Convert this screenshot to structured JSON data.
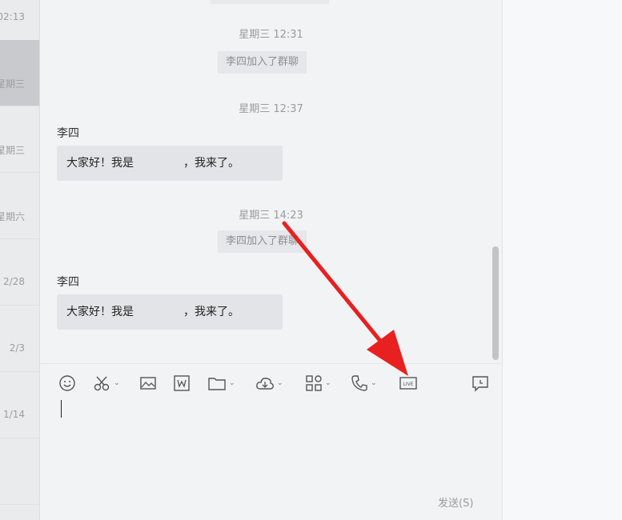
{
  "sidebar": {
    "items": [
      {
        "time": "02:13",
        "selected": false
      },
      {
        "time": "星期三",
        "selected": true
      },
      {
        "time": "星期三",
        "selected": false
      },
      {
        "time": "星期六",
        "selected": false
      },
      {
        "time": "2/28",
        "selected": false
      },
      {
        "time": "2/3",
        "selected": false
      },
      {
        "time": "1/14",
        "selected": false
      },
      {
        "time": "",
        "selected": false
      }
    ]
  },
  "chat": {
    "messages": [
      {
        "timestamp": "星期三 12:31",
        "system": "李四加入了群聊"
      },
      {
        "timestamp": "星期三 12:37",
        "sender": "李四",
        "text_start": "大家好！我是",
        "text_end": "，我来了。"
      },
      {
        "timestamp": "星期三 14:23",
        "system": "李四加入了群聊"
      },
      {
        "sender": "李四",
        "text_start": "大家好！我是",
        "text_end": "，我来了。"
      }
    ]
  },
  "toolbar": {
    "icons": [
      "emoji-icon",
      "screenshot-scissors-icon",
      "image-icon",
      "word-doc-icon",
      "folder-icon",
      "cloud-icon",
      "apps-icon",
      "phone-icon",
      "live-icon",
      "chat-history-icon"
    ]
  },
  "input": {
    "value": ""
  },
  "send_button": {
    "label": "发送(S)"
  },
  "annotation": {
    "color": "#e8201f"
  }
}
